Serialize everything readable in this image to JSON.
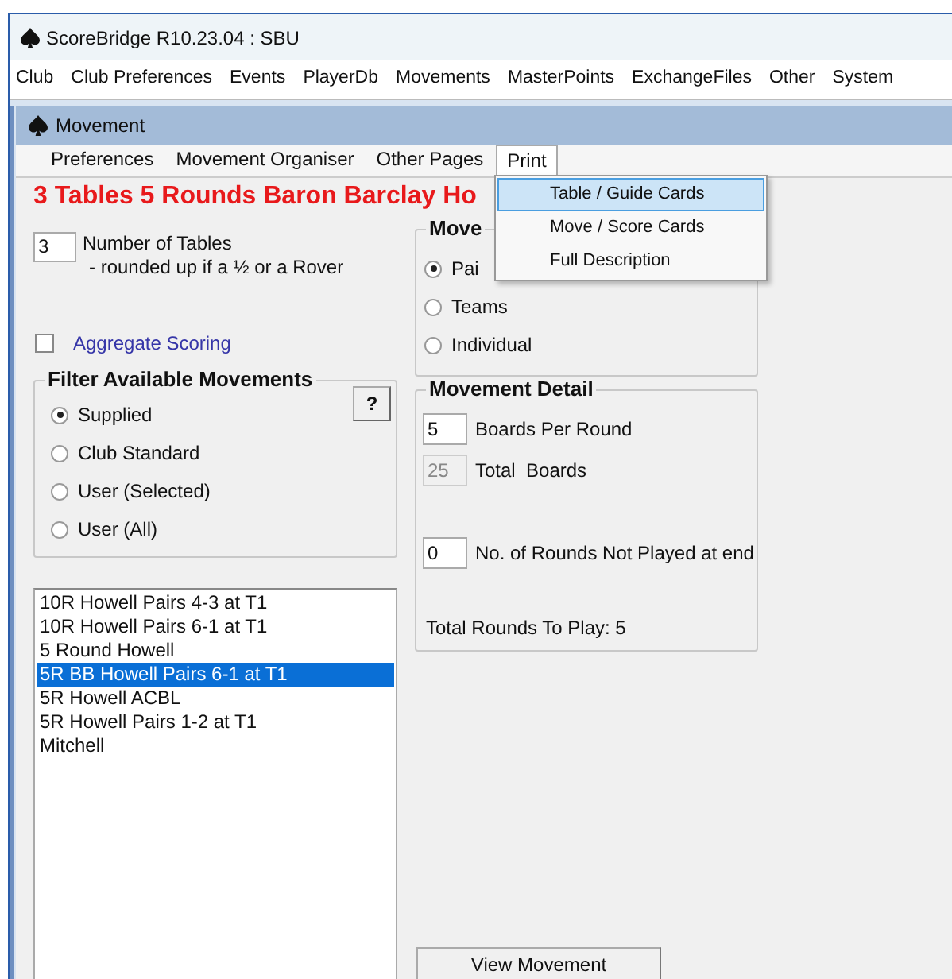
{
  "window": {
    "title": "ScoreBridge R10.23.04 : SBU"
  },
  "menu_bar": [
    "Club",
    "Club Preferences",
    "Events",
    "PlayerDb",
    "Movements",
    "MasterPoints",
    "ExchangeFiles",
    "Other",
    "System"
  ],
  "child_window": {
    "title": "Movement"
  },
  "tabs": [
    {
      "label": "Preferences",
      "selected": false
    },
    {
      "label": "Movement Organiser",
      "selected": false
    },
    {
      "label": "Other Pages",
      "selected": false
    },
    {
      "label": "Print",
      "selected": true
    }
  ],
  "print_menu": [
    {
      "label": "Table / Guide Cards",
      "selected": true
    },
    {
      "label": "Move / Score Cards",
      "selected": false
    },
    {
      "label": "Full Description",
      "selected": false
    }
  ],
  "heading": "3 Tables 5 Rounds Baron Barclay Ho",
  "tables": {
    "value": "3",
    "label": "Number of Tables",
    "note": "- rounded up if a ½ or a Rover"
  },
  "aggregate": {
    "label": "Aggregate Scoring",
    "checked": false
  },
  "filter": {
    "title": "Filter Available Movements",
    "help_button": "?",
    "options": [
      {
        "label": "Supplied",
        "selected": true
      },
      {
        "label": "Club Standard",
        "selected": false
      },
      {
        "label": "User (Selected)",
        "selected": false
      },
      {
        "label": "User (All)",
        "selected": false
      }
    ]
  },
  "movement_type": {
    "title": "Move",
    "options": [
      {
        "label": "Pai",
        "selected": true
      },
      {
        "label": "Teams",
        "selected": false
      },
      {
        "label": "Individual",
        "selected": false
      }
    ]
  },
  "movement_detail": {
    "title": "Movement Detail",
    "fields": [
      {
        "value": "5",
        "label": "Boards Per Round",
        "disabled": false
      },
      {
        "value": "25",
        "label": "Total  Boards",
        "disabled": true
      },
      {
        "value": "0",
        "label": "No. of Rounds Not Played at end",
        "disabled": false
      }
    ],
    "total": "Total Rounds To Play: 5"
  },
  "movements": [
    {
      "label": "10R Howell Pairs 4-3 at T1",
      "selected": false
    },
    {
      "label": "10R Howell Pairs 6-1 at T1",
      "selected": false
    },
    {
      "label": "5 Round Howell",
      "selected": false
    },
    {
      "label": "5R BB Howell Pairs 6-1 at T1",
      "selected": true
    },
    {
      "label": "5R Howell ACBL",
      "selected": false
    },
    {
      "label": "5R Howell Pairs 1-2 at T1",
      "selected": false
    },
    {
      "label": "Mitchell",
      "selected": false
    }
  ],
  "view_button": "View Movement"
}
